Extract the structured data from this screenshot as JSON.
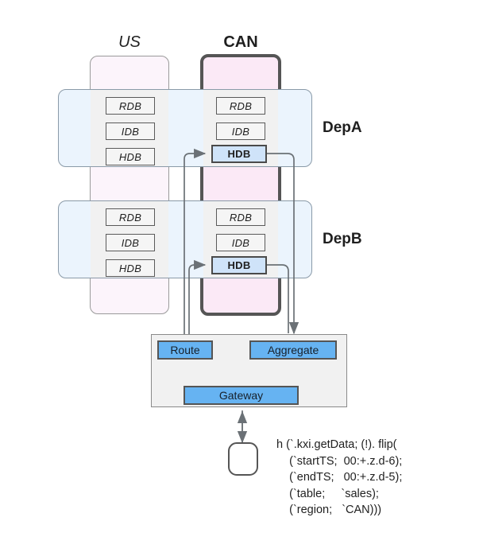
{
  "regions": [
    {
      "id": "us",
      "label": "US",
      "style": "italic"
    },
    {
      "id": "can",
      "label": "CAN",
      "style": "bold"
    }
  ],
  "departments": [
    {
      "id": "depA",
      "label": "DepA"
    },
    {
      "id": "depB",
      "label": "DepB"
    }
  ],
  "databases": {
    "us_depA": [
      {
        "label": "RDB"
      },
      {
        "label": "IDB"
      },
      {
        "label": "HDB"
      }
    ],
    "can_depA": [
      {
        "label": "RDB"
      },
      {
        "label": "IDB"
      },
      {
        "label": "HDB"
      }
    ],
    "us_depB": [
      {
        "label": "RDB"
      },
      {
        "label": "IDB"
      },
      {
        "label": "HDB"
      }
    ],
    "can_depB": [
      {
        "label": "RDB"
      },
      {
        "label": "IDB"
      },
      {
        "label": "HDB"
      }
    ]
  },
  "processes": {
    "route": "Route",
    "aggregate": "Aggregate",
    "gateway": "Gateway"
  },
  "client": {
    "label": ""
  },
  "code": {
    "lines": [
      "h (`.kxi.getData; (!). flip(",
      "    (`startTS;  00:+.z.d-6);",
      "    (`endTS;   00:+.z.d-5);",
      "    (`table;     `sales);",
      "    (`region;   `CAN)))"
    ],
    "text": "h (`.kxi.getData; (!). flip(\n    (`startTS;  00:+.z.d-6);\n    (`endTS;   00:+.z.d-5);\n    (`table;     `sales);\n    (`region;   `CAN)))"
  },
  "colors": {
    "region_us_fill": "#fcf4fb",
    "region_can_fill": "#fbe9f6",
    "dept_band_fill": "#ebf4fd",
    "cell_fill": "#f1f1f1",
    "db_fill": "#f5f5f5",
    "hdb_active_fill": "#cfe3f9",
    "process_fill": "#66b3f2",
    "stroke": "#555555",
    "connector": "#6b7176"
  }
}
